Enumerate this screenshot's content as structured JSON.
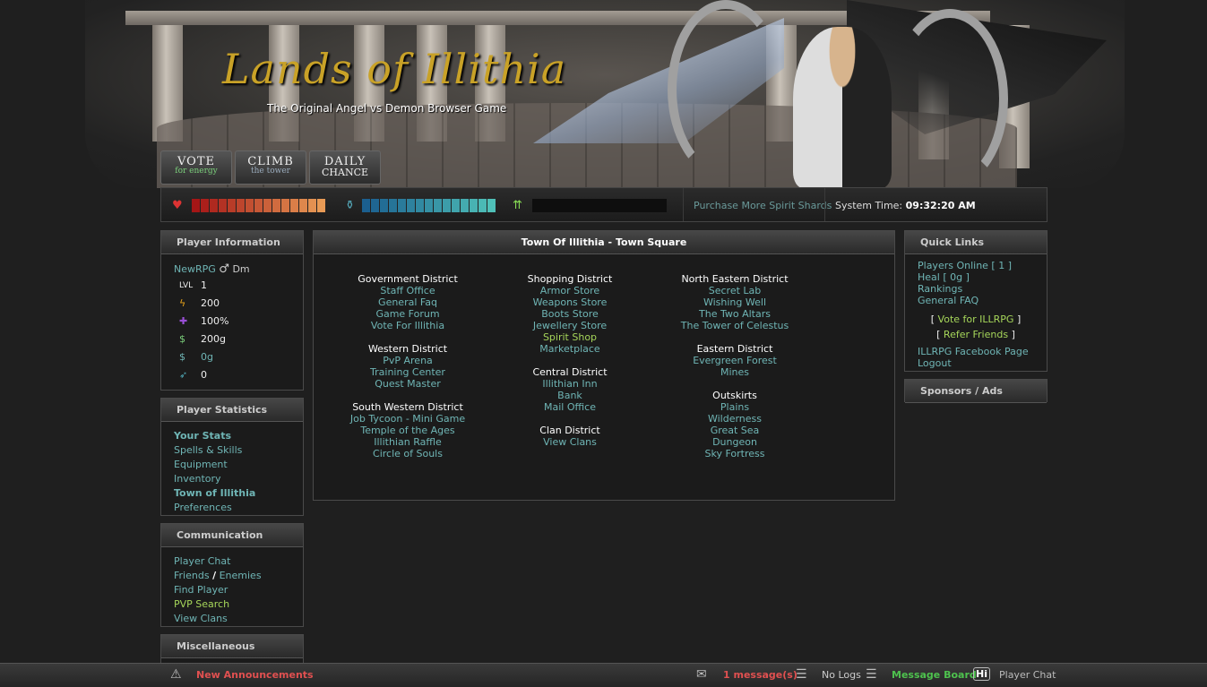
{
  "header": {
    "logo": "Lands of Illithia",
    "tagline": "The Original Angel vs Demon Browser Game",
    "buttons": [
      {
        "big": "VOTE",
        "small": "for energy"
      },
      {
        "big": "CLIMB",
        "small": "the tower"
      },
      {
        "big": "DAILY",
        "small": "CHANCE"
      }
    ]
  },
  "statusbar": {
    "purchase_link": "Purchase More Spirit Shards",
    "system_time_label": "System Time:",
    "system_time": "09:32:20 AM"
  },
  "player_info": {
    "title": "Player Information",
    "name": "NewRPG",
    "gender_icon": "male-icon",
    "class_label": "Dm",
    "rows": [
      {
        "icon": "level-icon",
        "glyph": "LVL",
        "value": "1"
      },
      {
        "icon": "energy-icon",
        "glyph": "ϟ",
        "value": "200"
      },
      {
        "icon": "puzzle-icon",
        "glyph": "✚",
        "value": "100%"
      },
      {
        "icon": "gold-icon",
        "glyph": "$",
        "value": "200g"
      },
      {
        "icon": "bank-icon",
        "glyph": "$",
        "value": "0g"
      },
      {
        "icon": "feather-icon",
        "glyph": "➶",
        "value": "0"
      }
    ]
  },
  "player_stats": {
    "title": "Player Statistics",
    "items": [
      "Your Stats",
      "Spells & Skills",
      "Equipment",
      "Inventory",
      "Town of Illithia",
      "Preferences"
    ]
  },
  "communication": {
    "title": "Communication",
    "player_chat": "Player Chat",
    "friends": "Friends",
    "slash": "/",
    "enemies": "Enemies",
    "find_player": "Find Player",
    "pvp_search": "PVP Search",
    "view_clans": "View Clans"
  },
  "misc": {
    "title": "Miscellaneous"
  },
  "town": {
    "title": "Town Of Illithia - Town Square",
    "col1": [
      {
        "title": "Government District",
        "links": [
          "Staff Office",
          "General Faq",
          "Game Forum",
          "Vote For Illithia"
        ]
      },
      {
        "title": "Western District",
        "links": [
          "PvP Arena",
          "Training Center",
          "Quest Master"
        ]
      },
      {
        "title": "South Western District",
        "links": [
          "Job Tycoon - Mini Game",
          "Temple of the Ages",
          "Illithian Raffle",
          "Circle of Souls"
        ]
      }
    ],
    "col2": [
      {
        "title": "Shopping District",
        "links": [
          "Armor Store",
          "Weapons Store",
          "Boots Store",
          "Jewellery Store",
          "Spirit Shop",
          "Marketplace"
        ]
      },
      {
        "title": "Central District",
        "links": [
          "Illithian Inn",
          "Bank",
          "Mail Office"
        ]
      },
      {
        "title": "Clan District",
        "links": [
          "View Clans"
        ]
      }
    ],
    "col3": [
      {
        "title": "North Eastern District",
        "links": [
          "Secret Lab",
          "Wishing Well",
          "The Two Altars",
          "The Tower of Celestus"
        ]
      },
      {
        "title": "Eastern District",
        "links": [
          "Evergreen Forest",
          "Mines"
        ]
      },
      {
        "title": "Outskirts",
        "links": [
          "Plains",
          "Wilderness",
          "Great Sea",
          "Dungeon",
          "Sky Fortress"
        ]
      }
    ]
  },
  "quick_links": {
    "title": "Quick Links",
    "players_online": "Players Online [ 1 ]",
    "heal": "Heal [ 0g ]",
    "rankings": "Rankings",
    "general_faq": "General FAQ",
    "vote": "Vote for ILLRPG",
    "refer": "Refer Friends",
    "bracket_open": "[",
    "bracket_close": "]",
    "facebook": "ILLRPG Facebook Page",
    "logout": "Logout"
  },
  "sponsors": {
    "title": "Sponsors / Ads"
  },
  "bottombar": {
    "announcements": "New Announcements",
    "messages": "1 message(s)",
    "logs": "No Logs",
    "message_board": "Message Board",
    "player_chat": "Player Chat"
  },
  "colors": {
    "health_start": "#a51616",
    "health_end": "#e89a55",
    "mana_start": "#1b5f8f",
    "mana_end": "#4fc0b8",
    "accent_link": "#6fb5b5",
    "highlight_link": "#a6d65a"
  }
}
